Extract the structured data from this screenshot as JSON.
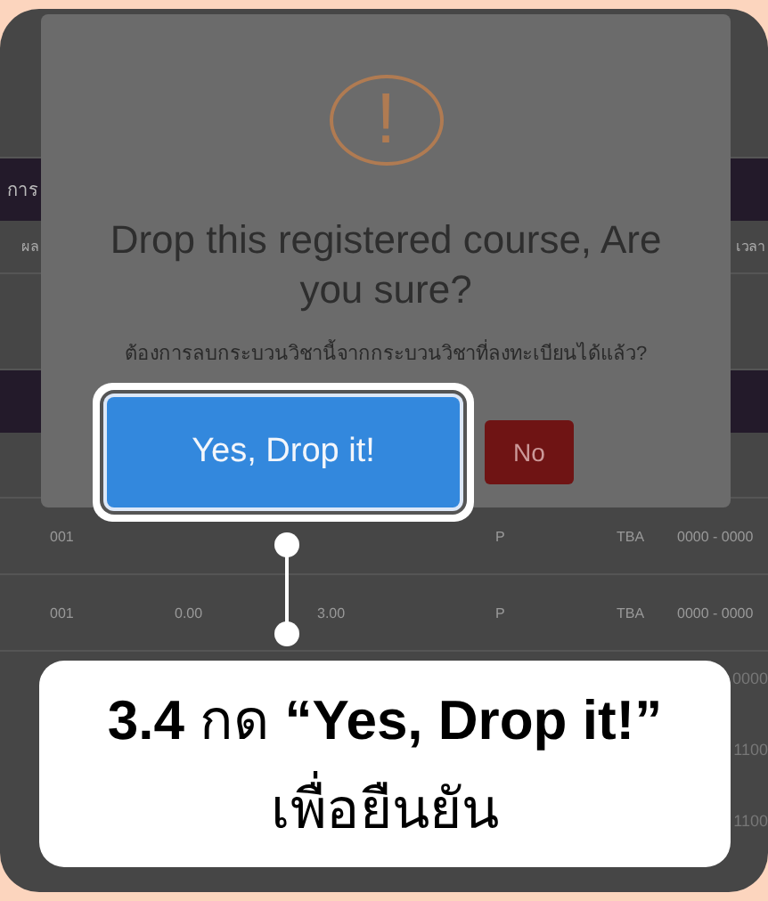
{
  "background_page": {
    "section_title": "การ",
    "table_header": {
      "column_1": "ผล",
      "column_6": "เวลา"
    },
    "rows": [
      {
        "column_1": "001",
        "column_4": "P",
        "column_5": "TBA",
        "column_6": "0000 - 0000"
      },
      {
        "column_1": "001",
        "column_2": "0.00",
        "column_3": "3.00",
        "column_4": "P",
        "column_5": "TBA",
        "column_6": "0000 - 0000"
      }
    ],
    "right_edge_cells": [
      "0000",
      "1100",
      "1100"
    ]
  },
  "dialog": {
    "icon": "!",
    "title": "Drop this registered course, Are you sure?",
    "message": "ต้องการลบกระบวนวิชานี้จากกระบวนวิชาที่ลงทะเบียนได้แล้ว?",
    "buttons": [
      {
        "label": "Yes, Drop it!",
        "kind": "confirm",
        "highlighted": true
      },
      {
        "label": "No",
        "kind": "cancel",
        "highlighted": false
      }
    ]
  },
  "annotation": {
    "step": "3.4",
    "verb": "กด",
    "quote": "“Yes, Drop it!”",
    "line2": "เพื่อยืนยัน"
  }
}
